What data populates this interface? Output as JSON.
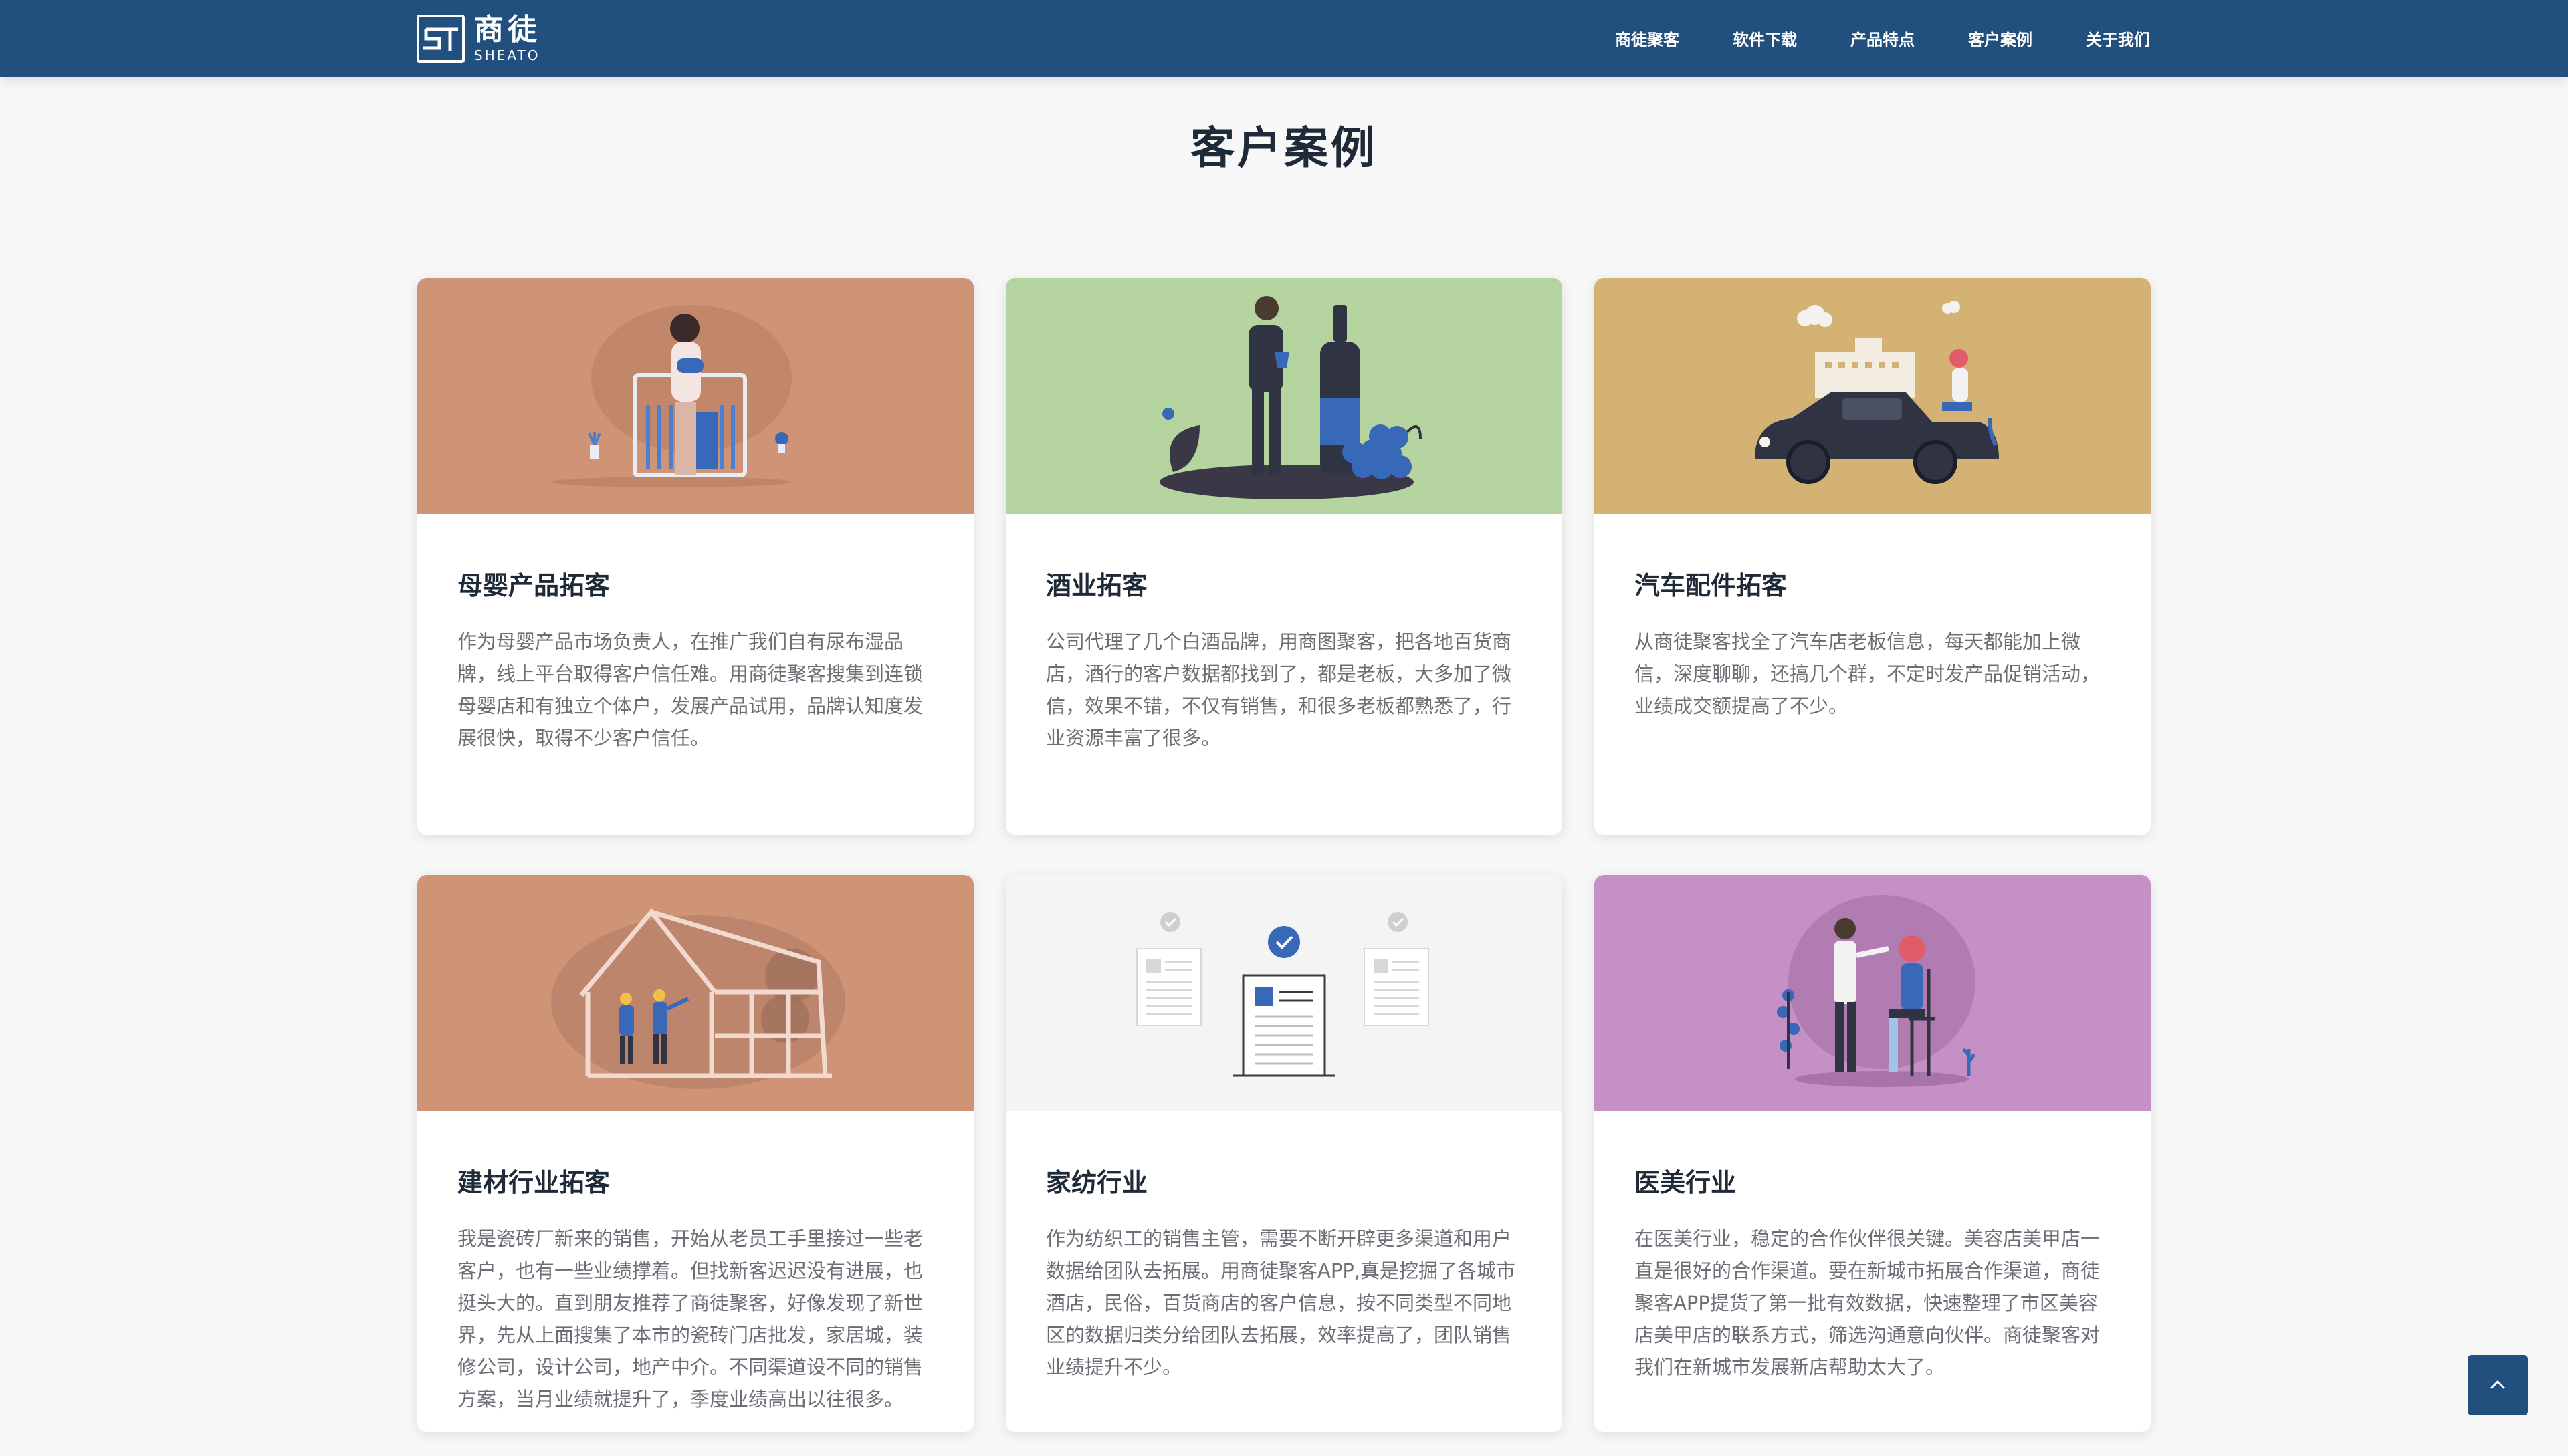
{
  "brand": {
    "name_cn": "商徒",
    "name_en": "SHEATO",
    "logo_icon": "st-logo-icon"
  },
  "nav": [
    {
      "label": "商徒聚客"
    },
    {
      "label": "软件下载"
    },
    {
      "label": "产品特点"
    },
    {
      "label": "客户案例"
    },
    {
      "label": "关于我们"
    }
  ],
  "page_title": "客户案例",
  "colors": {
    "header": "#21507f",
    "card1": "#cf9475",
    "card2": "#b6d4a0",
    "card3": "#d4b273",
    "card4": "#cf9475",
    "card5": "#f4f4f4",
    "card6": "#c590c6"
  },
  "cards": [
    {
      "title": "母婴产品拓客",
      "text": "作为母婴产品市场负责人，在推广我们自有尿布湿品牌，线上平台取得客户信任难。用商徒聚客搜集到连锁母婴店和有独立个体户，发展产品试用，品牌认知度发展很快，取得不少客户信任。",
      "illustration": "mother-baby-crib-illustration"
    },
    {
      "title": "酒业拓客",
      "text": "公司代理了几个白酒品牌，用商图聚客，把各地百货商店，酒行的客户数据都找到了，都是老板，大多加了微信，效果不错，不仅有销售，和很多老板都熟悉了，行业资源丰富了很多。",
      "illustration": "wine-bottle-illustration"
    },
    {
      "title": "汽车配件拓客",
      "text": "从商徒聚客找全了汽车店老板信息，每天都能加上微信，深度聊聊，还搞几个群，不定时发产品促销活动，业绩成交额提高了不少。",
      "illustration": "car-illustration"
    },
    {
      "title": "建材行业拓客",
      "text": "我是瓷砖厂新来的销售，开始从老员工手里接过一些老客户，也有一些业绩撑着。但找新客迟迟没有进展，也挺头大的。直到朋友推荐了商徒聚客，好像发现了新世界，先从上面搜集了本市的瓷砖门店批发，家居城，装修公司，设计公司，地产中介。不同渠道设不同的销售方案，当月业绩就提升了，季度业绩高出以往很多。",
      "illustration": "construction-frame-illustration"
    },
    {
      "title": "家纺行业",
      "text": "作为纺织工的销售主管，需要不断开辟更多渠道和用户数据给团队去拓展。用商徒聚客APP,真是挖掘了各城市酒店，民俗，百货商店的客户信息，按不同类型不同地区的数据归类分给团队去拓展，效率提高了，团队销售业绩提升不少。",
      "illustration": "documents-check-illustration"
    },
    {
      "title": "医美行业",
      "text": "在医美行业，稳定的合作伙伴很关键。美容店美甲店一直是很好的合作渠道。要在新城市拓展合作渠道，商徒聚客APP提货了第一批有效数据，快速整理了市区美容店美甲店的联系方式，筛选沟通意向伙伴。商徒聚客对我们在新城市发展新店帮助太大了。",
      "illustration": "beauty-salon-illustration"
    }
  ],
  "back_to_top": {
    "icon": "chevron-up-icon"
  }
}
